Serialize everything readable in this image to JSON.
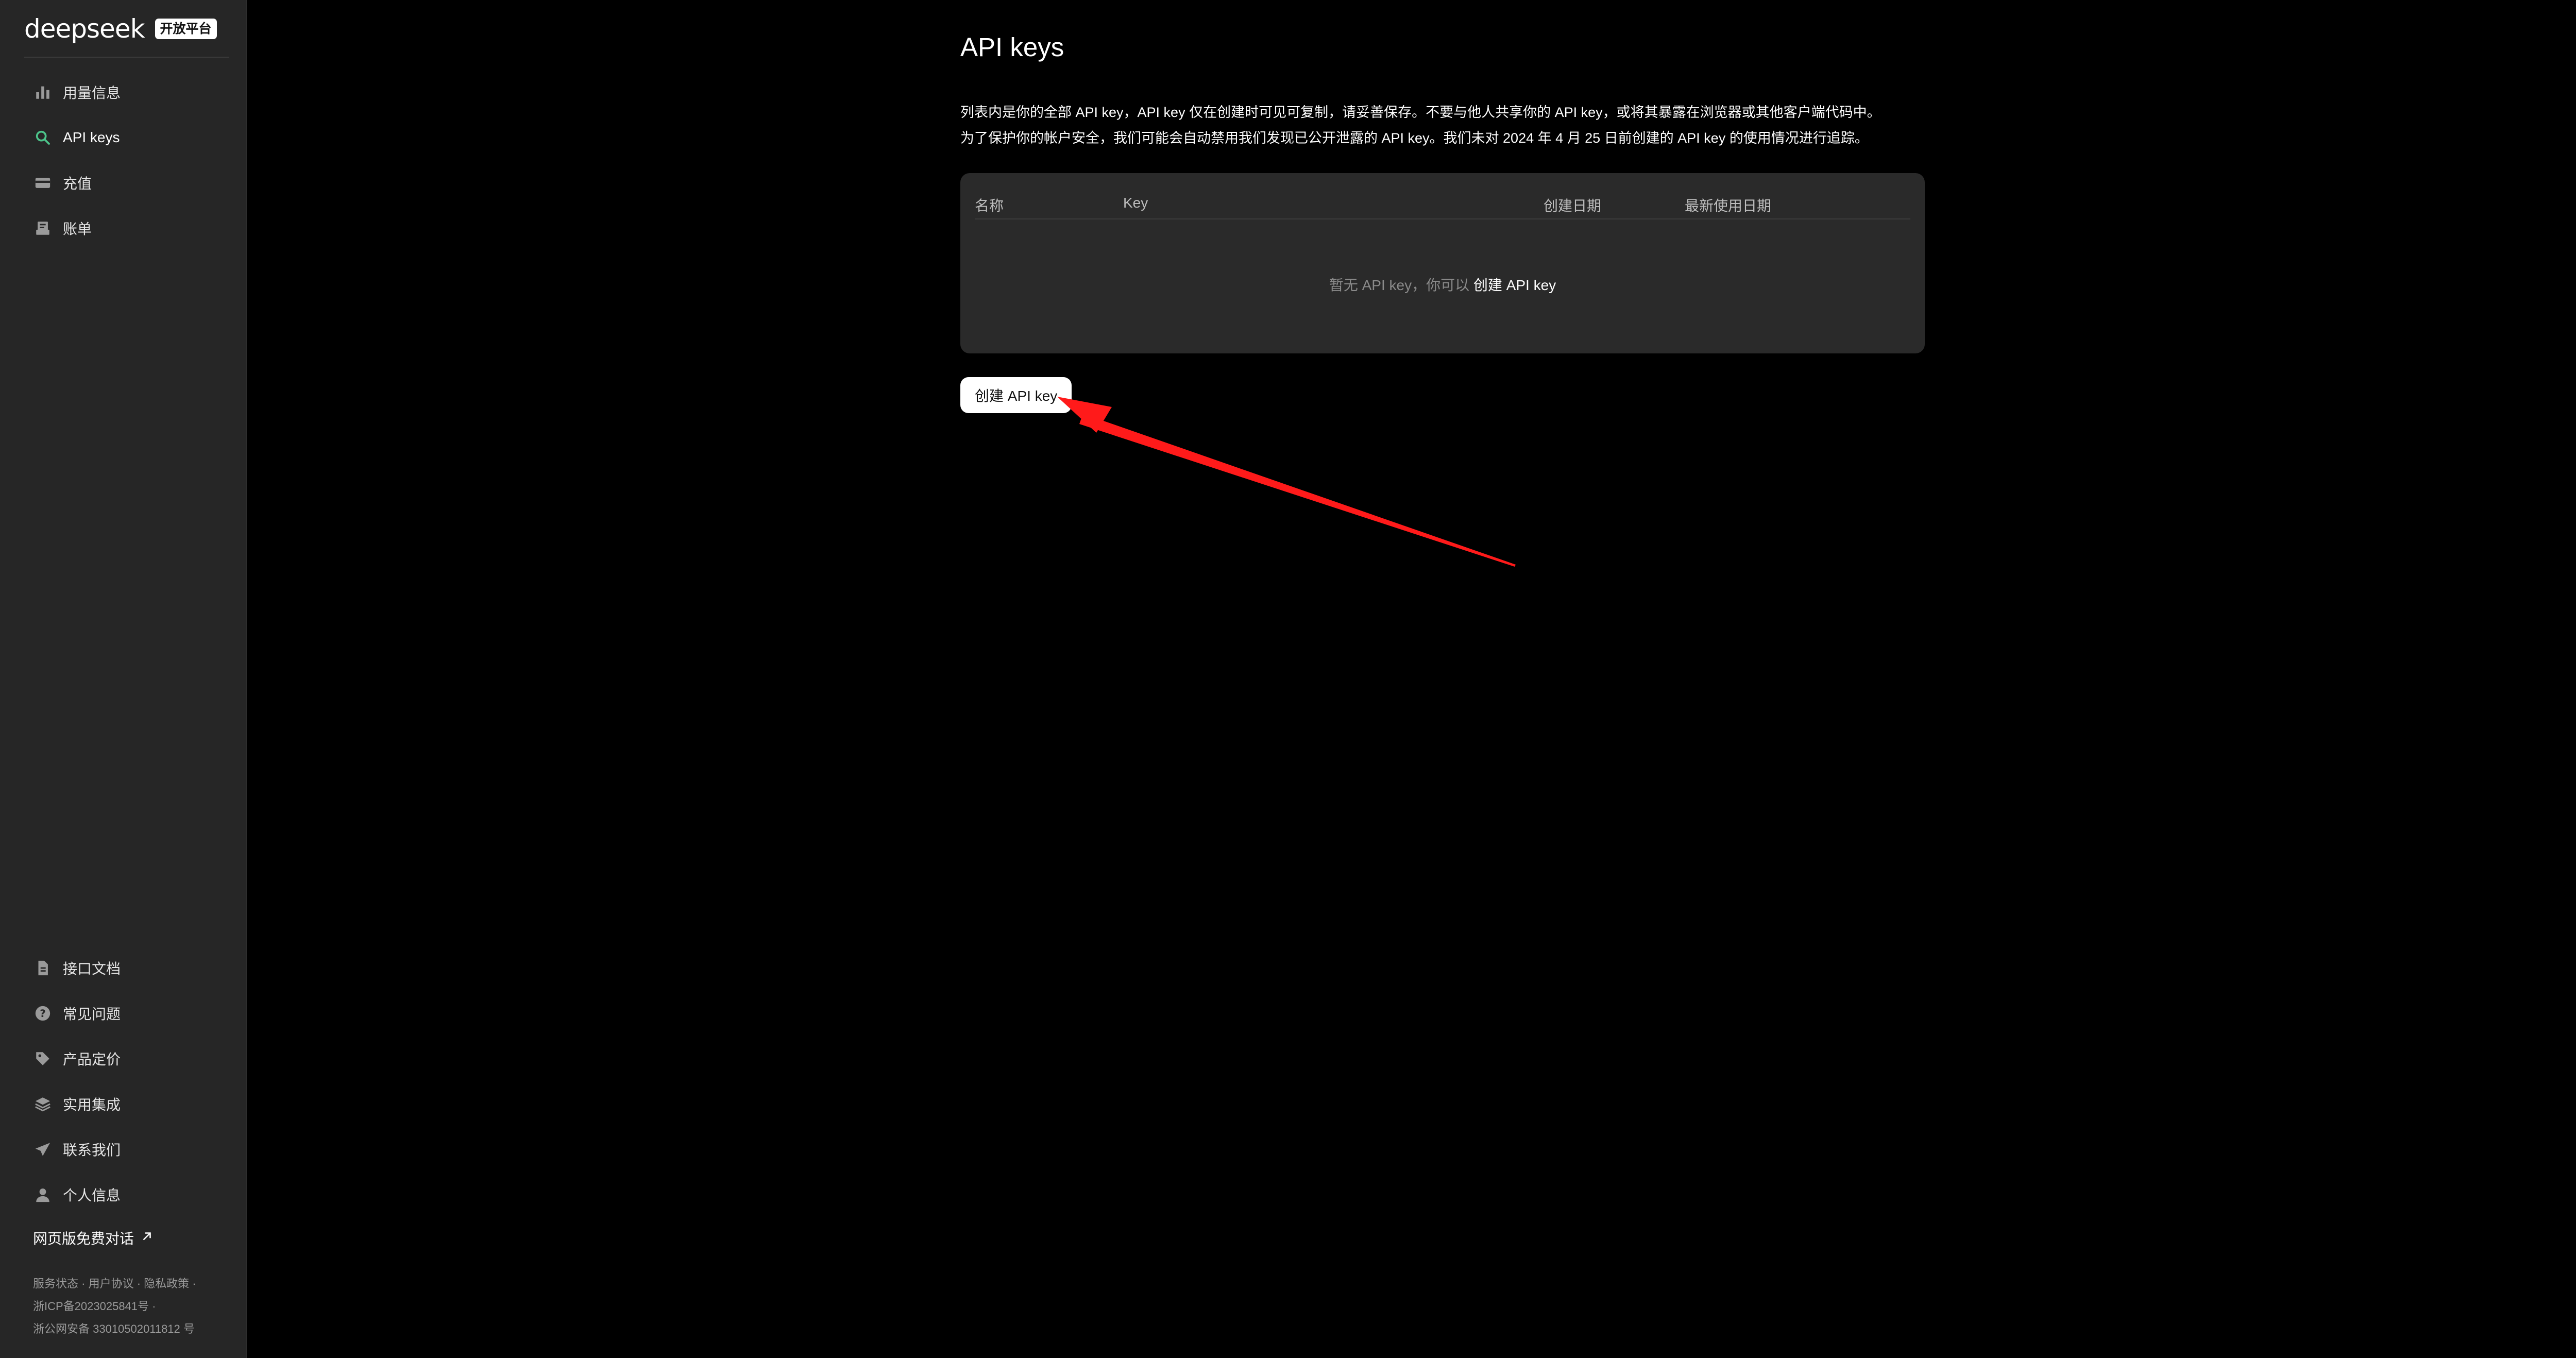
{
  "brand": {
    "logo": "deepseek",
    "badge": "开放平台"
  },
  "sidebar": {
    "top_items": [
      {
        "label": "用量信息",
        "icon": "bar-chart-icon"
      },
      {
        "label": "API keys",
        "icon": "search-icon",
        "active": true
      },
      {
        "label": "充值",
        "icon": "card-icon"
      },
      {
        "label": "账单",
        "icon": "receipt-icon"
      }
    ],
    "bottom_items": [
      {
        "label": "接口文档",
        "icon": "document-icon"
      },
      {
        "label": "常见问题",
        "icon": "question-icon"
      },
      {
        "label": "产品定价",
        "icon": "tag-icon"
      },
      {
        "label": "实用集成",
        "icon": "layers-icon"
      },
      {
        "label": "联系我们",
        "icon": "send-icon"
      },
      {
        "label": "个人信息",
        "icon": "person-icon"
      }
    ],
    "web_chat": "网页版免费对话",
    "footer": {
      "service_status": "服务状态",
      "user_agreement": "用户协议",
      "privacy_policy": "隐私政策",
      "icp": "浙ICP备2023025841号",
      "police": "浙公网安备 33010502011812 号"
    },
    "accent_color": "#4cc38a"
  },
  "main": {
    "title": "API keys",
    "description_line1": "列表内是你的全部 API key，API key 仅在创建时可见可复制，请妥善保存。不要与他人共享你的 API key，或将其暴露在浏览器或其他客户端代码中。",
    "description_line2": "为了保护你的帐户安全，我们可能会自动禁用我们发现已公开泄露的 API key。我们未对 2024 年 4 月 25 日前创建的 API key 的使用情况进行追踪。",
    "table": {
      "columns": [
        "名称",
        "Key",
        "创建日期",
        "最新使用日期"
      ],
      "empty_text": "暂无 API key，你可以",
      "empty_link": "创建 API key"
    },
    "create_button": "创建 API key"
  },
  "annotation": {
    "arrow_color": "#ff1a1a"
  }
}
